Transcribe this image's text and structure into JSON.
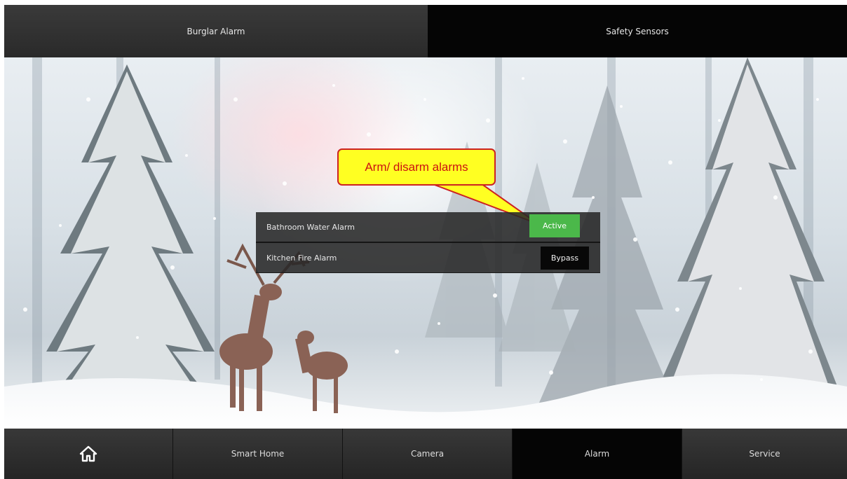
{
  "top_tabs": {
    "burglar_alarm": "Burglar Alarm",
    "safety_sensors": "Safety Sensors"
  },
  "callout": {
    "text": "Arm/ disarm alarms"
  },
  "sensors": [
    {
      "label": "Bathroom Water Alarm",
      "button": "Active",
      "button_color": "#4bb84a"
    },
    {
      "label": "Kitchen Fire Alarm",
      "button": "Bypass",
      "button_color": "#080808"
    }
  ],
  "bottom_nav": {
    "home_icon": "home-icon",
    "smart_home": "Smart Home",
    "camera": "Camera",
    "alarm": "Alarm",
    "service": "Service",
    "selected": "Alarm"
  },
  "colors": {
    "callout_fill": "#ffff22",
    "callout_border": "#cc2222",
    "active_green": "#4bb84a"
  }
}
